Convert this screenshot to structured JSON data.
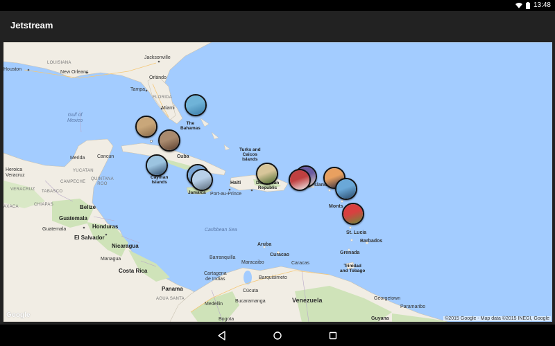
{
  "status_bar": {
    "time": "13:48"
  },
  "app": {
    "title": "Jetstream"
  },
  "map": {
    "attribution": "©2015 Google - Map data ©2015 INEGI, Google",
    "logo": "Google",
    "labels": {
      "jacksonville": "Jacksonville",
      "louisiana": "LOUISIANA",
      "houston": "Houston",
      "new_orleans": "New Orleans",
      "orlando": "Orlando",
      "tampa": "Tampa",
      "florida": "FLORIDA",
      "miami": "Miami",
      "gulf": "Gulf of\nMexico",
      "bahamas": "The\nBahamas",
      "cuba": "Cuba",
      "turks": "Turks and\nCaicos\nIslands",
      "merida": "Merida",
      "cancun": "Cancun",
      "yucatan": "YUCATAN",
      "heroica": "Heroica\nVeracruz",
      "campeche": "CAMPECHE",
      "quintana": "QUINTANA\nROO",
      "veracruz": "VERACRUZ",
      "tabasco": "TABASCO",
      "oaxaca": "AXACA",
      "chiapas": "CHIAPAS",
      "belize": "Belize",
      "cayman": "Cayman\nIslands",
      "jamaica": "Jamaica",
      "haiti": "Haiti",
      "port_au_prince": "Port-au-Prince",
      "dominican": "Dominican\nRepublic",
      "guatemala_country": "Guatemala",
      "guatemala_city": "Guatemala",
      "honduras": "Honduras",
      "el_salvador": "El Salvador",
      "nicaragua": "Nicaragua",
      "managua": "Managua",
      "costa_rica": "Costa Rica",
      "panama": "Panama",
      "caribbean_sea": "Caribbean Sea",
      "aruba": "Aruba",
      "curacao": "Curacao",
      "maracaibo": "Maracaibo",
      "caracas": "Caracas",
      "barranquilla": "Barranquilla",
      "cartagena": "Cartagena\nde Indias",
      "barquisimeto": "Barquisimeto",
      "venezuela": "Venezuela",
      "medellin": "Medellin",
      "bucaramanga": "Bucaramanga",
      "cucuta": "Cúcuta",
      "bogota": "Bogota",
      "agua_santa": "AGUA SANTA",
      "grenada": "Grenada",
      "trinidad": "Trinidad\nand Tobago",
      "barbados": "Barbados",
      "st_lucia": "St. Lucia",
      "montserrat": "Monts",
      "virgin": "slands",
      "georgetown": "Georgetown",
      "paramaribo": "Paramaribo",
      "guyana": "Guyana"
    },
    "markers": [
      {
        "name": "bahamas-photo",
        "colors": [
          "#6fb3d8",
          "#3a7ca8"
        ]
      },
      {
        "name": "miami-photo",
        "colors": [
          "#c9a77a",
          "#8a6a48"
        ]
      },
      {
        "name": "havana-photo",
        "colors": [
          "#a98a6e",
          "#5a3e2e"
        ]
      },
      {
        "name": "cayman-photo",
        "colors": [
          "#9cc4e0",
          "#2e4a6a"
        ]
      },
      {
        "name": "jamaica-photo-1",
        "colors": [
          "#7aa6d6",
          "#24364a"
        ]
      },
      {
        "name": "jamaica-photo-2",
        "colors": [
          "#b8d0e8",
          "#5a6a7a"
        ]
      },
      {
        "name": "dominican-photo",
        "colors": [
          "#d8c69a",
          "#4a6a2e"
        ]
      },
      {
        "name": "puerto-rico-photo-1",
        "colors": [
          "#c04040",
          "#f0f0f0"
        ]
      },
      {
        "name": "puerto-rico-photo-2",
        "colors": [
          "#6a5aa0",
          "#e8d8c0"
        ]
      },
      {
        "name": "virgin-islands-photo",
        "colors": [
          "#e8a060",
          "#2a2a40"
        ]
      },
      {
        "name": "antigua-photo",
        "colors": [
          "#6aa8d8",
          "#2a4a6a"
        ]
      },
      {
        "name": "st-lucia-photo",
        "colors": [
          "#d84040",
          "#6a8a3a"
        ]
      }
    ]
  }
}
